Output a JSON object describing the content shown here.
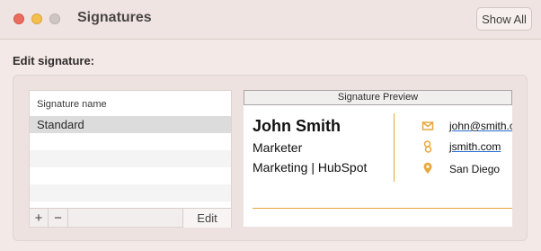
{
  "window": {
    "title": "Signatures",
    "show_all_label": "Show All"
  },
  "section": {
    "label": "Edit signature:"
  },
  "list": {
    "header": "Signature name",
    "items": [
      "Standard"
    ],
    "add_label": "+",
    "remove_label": "−",
    "edit_label": "Edit"
  },
  "preview": {
    "header": "Signature Preview",
    "name": "John Smith",
    "role": "Marketer",
    "org": "Marketing | HubSpot",
    "email": "john@smith.c",
    "website": "jsmith.com",
    "location": "San Diego",
    "accent_color": "#e8a83b",
    "icons": [
      "mail-icon",
      "link-icon",
      "location-pin-icon"
    ]
  }
}
